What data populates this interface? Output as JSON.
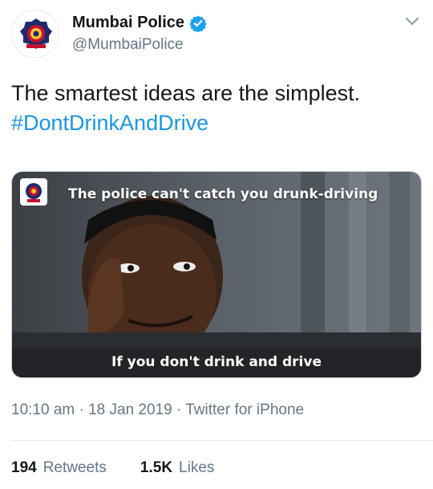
{
  "profile": {
    "display_name": "Mumbai Police",
    "handle": "@MumbaiPolice",
    "avatar_icon": "police-emblem-icon",
    "verified_color": "#1da1f2"
  },
  "tweet": {
    "text": "The smartest ideas are the simplest.",
    "hashtag": "#DontDrinkAndDrive",
    "hashtag_color": "#1b95e0"
  },
  "media": {
    "caption_top": "The police can't catch you drunk-driving",
    "caption_bottom": "If you don't drink and drive"
  },
  "meta": {
    "timestamp": "10:10 am · 18 Jan 2019 · Twitter for iPhone"
  },
  "stats": {
    "retweets_count": "194",
    "retweets_label": "Retweets",
    "likes_count": "1.5K",
    "likes_label": "Likes"
  }
}
